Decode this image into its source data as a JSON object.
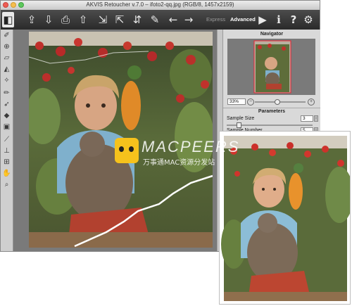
{
  "window": {
    "title": "AKVIS Retoucher v.7.0 – ifoto2-qq.jpg (RGB/8, 1457x2159)",
    "traffic_lights": [
      {
        "name": "close",
        "color": "#ee5c54"
      },
      {
        "name": "minimize",
        "color": "#f5be4f"
      },
      {
        "name": "zoom",
        "color": "#5ec85d"
      }
    ]
  },
  "toolbar": {
    "buttons": [
      {
        "name": "logo-icon",
        "glyph": "◧"
      },
      {
        "name": "open-file-icon",
        "glyph": "⇪"
      },
      {
        "name": "save-file-icon",
        "glyph": "⇩"
      },
      {
        "name": "print-icon",
        "glyph": "⎙"
      },
      {
        "name": "share-icon",
        "glyph": "⇧"
      },
      {
        "name": "import-strokes-icon",
        "glyph": "⇲"
      },
      {
        "name": "export-strokes-icon",
        "glyph": "⇱"
      },
      {
        "name": "export-icon",
        "glyph": "⇵"
      },
      {
        "name": "preset-strokes-icon",
        "glyph": "✎"
      },
      {
        "name": "undo-icon",
        "glyph": "←"
      },
      {
        "name": "redo-icon",
        "glyph": "→"
      },
      {
        "name": "run-icon",
        "glyph": "▶"
      },
      {
        "name": "info-icon",
        "glyph": "i"
      },
      {
        "name": "help-icon",
        "glyph": "?"
      },
      {
        "name": "settings-icon",
        "glyph": "⚙"
      }
    ],
    "mode_express": "Express",
    "mode_advanced": "Advanced"
  },
  "tools": [
    {
      "name": "brush-tool-icon",
      "glyph": "✐"
    },
    {
      "name": "clone-tool-icon",
      "glyph": "⊕"
    },
    {
      "name": "eraser-tool-icon",
      "glyph": "▱"
    },
    {
      "name": "fill-tool-icon",
      "glyph": "◭"
    },
    {
      "name": "magic-wand-tool-icon",
      "glyph": "✧"
    },
    {
      "name": "pencil-tool-icon",
      "glyph": "✏"
    },
    {
      "name": "smudge-tool-icon",
      "glyph": "➶"
    },
    {
      "name": "chameleon-brush-icon",
      "glyph": "◆"
    },
    {
      "name": "healing-brush-icon",
      "glyph": "▣"
    },
    {
      "name": "eyedropper-tool-icon",
      "glyph": "⟋"
    },
    {
      "name": "stamp-tool-icon",
      "glyph": "⊥"
    },
    {
      "name": "patch-tool-icon",
      "glyph": "⊞"
    },
    {
      "name": "hand-tool-icon",
      "glyph": "✋"
    },
    {
      "name": "zoom-tool-icon",
      "glyph": "⌕"
    }
  ],
  "navigator": {
    "title": "Navigator",
    "zoom": "33%"
  },
  "parameters": {
    "title": "Parameters",
    "sample_size_label": "Sample Size",
    "sample_size_value": "3",
    "sample_number_label": "Sample Number",
    "sample_number_value": "5"
  },
  "watermark": {
    "brand": "MACPEERS",
    "subtitle": "万事通MAC资源分发站"
  },
  "colors": {
    "toolbar_bg": "#333333",
    "advanced_active": "#ffffff",
    "express_inactive": "#9a9a9a",
    "watermark_yellow": "#f6c21c"
  }
}
